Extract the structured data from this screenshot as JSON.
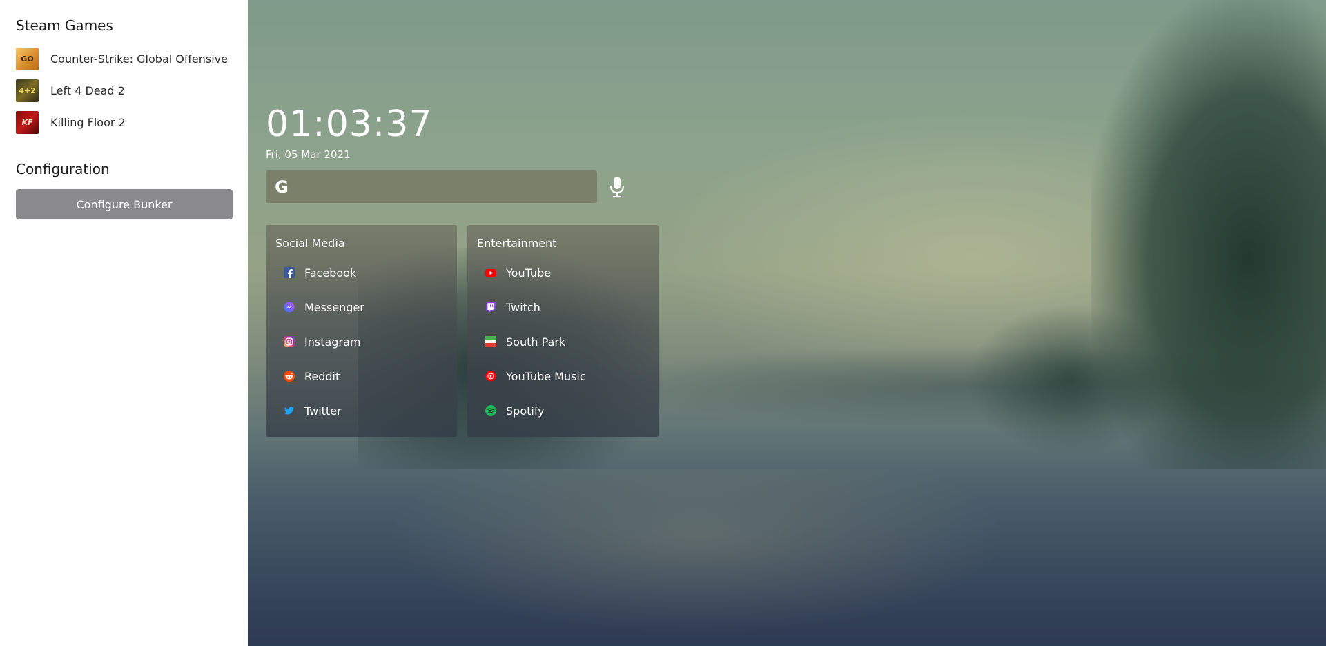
{
  "sidebar": {
    "steam_heading": "Steam Games",
    "games": [
      {
        "label": "Counter-Strike: Global Offensive",
        "thumb_text": "GO",
        "icon": "csgo-icon"
      },
      {
        "label": "Left 4 Dead 2",
        "thumb_text": "4+2",
        "icon": "left4dead2-icon"
      },
      {
        "label": "Killing Floor 2",
        "thumb_text": "KF",
        "icon": "killingfloor2-icon"
      }
    ],
    "config_heading": "Configuration",
    "config_button": "Configure Bunker"
  },
  "main": {
    "clock": "01:03:37",
    "date": "Fri, 05 Mar 2021",
    "search": {
      "engine_icon": "google-icon",
      "engine_glyph": "G",
      "value": "",
      "placeholder": "",
      "mic_icon": "microphone-icon"
    },
    "cards": [
      {
        "title": "Social Media",
        "links": [
          {
            "label": "Facebook",
            "icon": "facebook-icon",
            "color": "#3b5998"
          },
          {
            "label": "Messenger",
            "icon": "messenger-icon",
            "color": "#8a5cf6"
          },
          {
            "label": "Instagram",
            "icon": "instagram-icon",
            "color": "#e1306c"
          },
          {
            "label": "Reddit",
            "icon": "reddit-icon",
            "color": "#ff4500"
          },
          {
            "label": "Twitter",
            "icon": "twitter-icon",
            "color": "#1da1f2"
          }
        ]
      },
      {
        "title": "Entertainment",
        "links": [
          {
            "label": "YouTube",
            "icon": "youtube-icon",
            "color": "#ff0000"
          },
          {
            "label": "Twitch",
            "icon": "twitch-icon",
            "color": "#9146ff"
          },
          {
            "label": "South Park",
            "icon": "south-park-icon",
            "color": "#e53935"
          },
          {
            "label": "YouTube Music",
            "icon": "youtube-music-icon",
            "color": "#ff0000"
          },
          {
            "label": "Spotify",
            "icon": "spotify-icon",
            "color": "#1db954"
          }
        ]
      }
    ]
  },
  "colors": {
    "sidebar_bg": "#ffffff",
    "button_bg": "#8a8a8c",
    "text_dark": "#1b1b1b",
    "text_light": "#ffffff"
  }
}
